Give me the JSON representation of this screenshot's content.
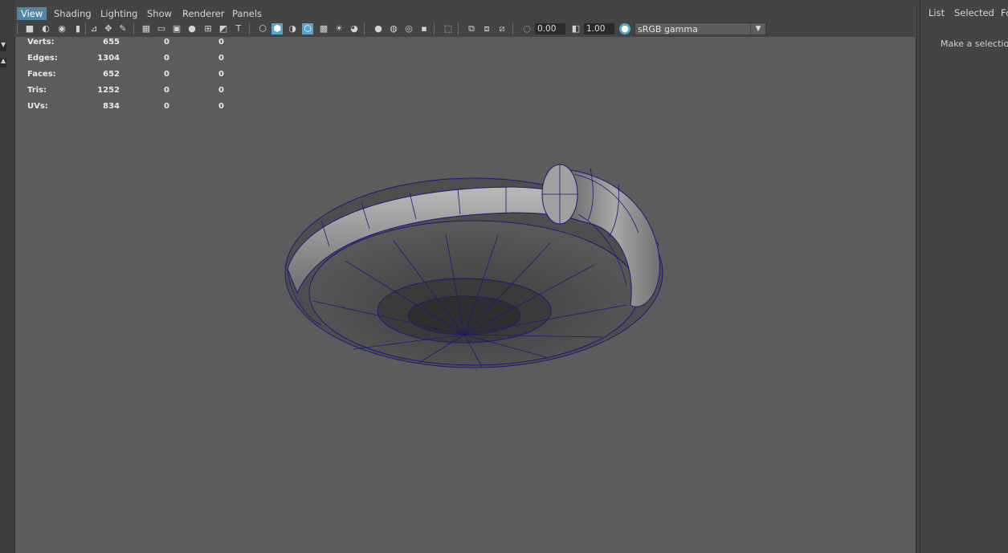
{
  "menubar": {
    "items": [
      {
        "label": "View",
        "active": true
      },
      {
        "label": "Shading"
      },
      {
        "label": "Lighting"
      },
      {
        "label": "Show"
      },
      {
        "label": "Renderer"
      },
      {
        "label": "Panels"
      }
    ]
  },
  "toolbar": {
    "exposure_value": "0.00",
    "gamma_value": "1.00",
    "color_space": "sRGB gamma",
    "icons": [
      "select-camera-icon",
      "camera-attributes-icon",
      "bookmark-icon",
      "image-plane-icon",
      "grid-icon",
      "film-gate-icon",
      "resolution-gate-icon",
      "safe-action-icon",
      "wireframe-icon",
      "smooth-shade-icon",
      "textured-icon",
      "lights-icon",
      "shadows-icon",
      "ambient-occlusion-icon",
      "motion-blur-icon",
      "isolate-select-icon",
      "xray-icon",
      "exposure-icon",
      "gamma-icon",
      "color-management-icon"
    ]
  },
  "hud": {
    "rows": [
      {
        "label": "Verts:",
        "v1": "655",
        "v2": "0",
        "v3": "0"
      },
      {
        "label": "Edges:",
        "v1": "1304",
        "v2": "0",
        "v3": "0"
      },
      {
        "label": "Faces:",
        "v1": "652",
        "v2": "0",
        "v3": "0"
      },
      {
        "label": "Tris:",
        "v1": "1252",
        "v2": "0",
        "v3": "0"
      },
      {
        "label": "UVs:",
        "v1": "834",
        "v2": "0",
        "v3": "0"
      }
    ]
  },
  "right_panel": {
    "menu": [
      "List",
      "Selected",
      "Fo"
    ],
    "message": "Make a selection"
  },
  "colors": {
    "viewport_bg": "#5c5c5c",
    "ui_bg": "#444444",
    "active_menu": "#5285a6",
    "toggle_on": "#5aa6c8",
    "wireframe": "#1a1a7a"
  }
}
